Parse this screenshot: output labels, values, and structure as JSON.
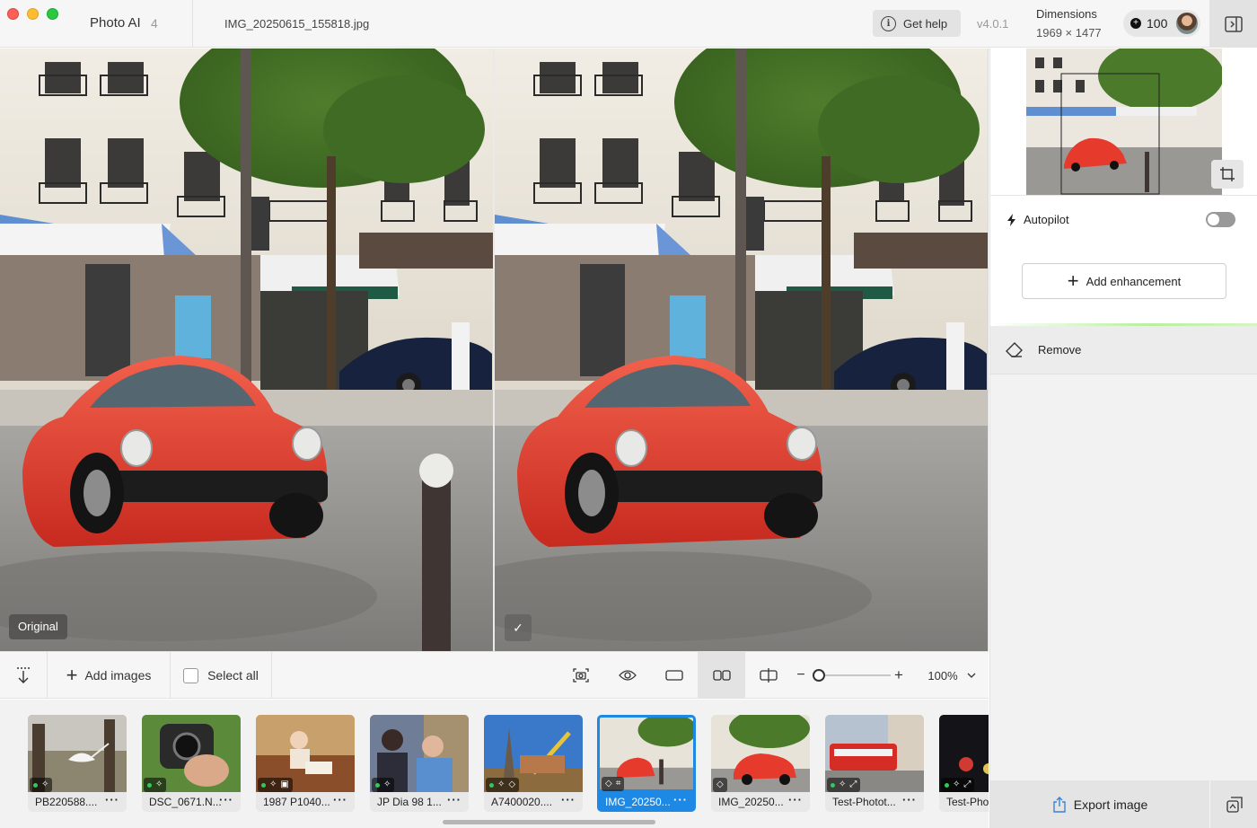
{
  "window": {
    "app_name": "Photo AI",
    "image_count": "4",
    "file_name": "IMG_20250615_155818.jpg",
    "help_label": "Get help",
    "version": "v4.0.1",
    "dimensions_label": "Dimensions",
    "dimensions_value": "1969 × 1477",
    "credits": "100"
  },
  "viewer": {
    "original_badge": "Original",
    "processed_badge": "✓"
  },
  "toolbar": {
    "add_images": "Add images",
    "select_all": "Select all",
    "zoom": "100%"
  },
  "filmstrip": [
    {
      "label": "PB220588....",
      "selected": false
    },
    {
      "label": "DSC_0671.N...",
      "selected": false
    },
    {
      "label": "1987 P1040...",
      "selected": false
    },
    {
      "label": "JP Dia 98 1...",
      "selected": false
    },
    {
      "label": "A7400020....",
      "selected": false
    },
    {
      "label": "IMG_20250...",
      "selected": true
    },
    {
      "label": "IMG_20250...",
      "selected": false
    },
    {
      "label": "Test-Photot...",
      "selected": false
    },
    {
      "label": "Test-Pho",
      "selected": false
    }
  ],
  "sidebar": {
    "autopilot_label": "Autopilot",
    "autopilot_on": false,
    "add_enhancement": "Add enhancement",
    "remove_label": "Remove",
    "export_label": "Export image"
  },
  "colors": {
    "accent": "#1e88e5",
    "car_red": "#e53a2c",
    "toggle_off": "#999999"
  }
}
